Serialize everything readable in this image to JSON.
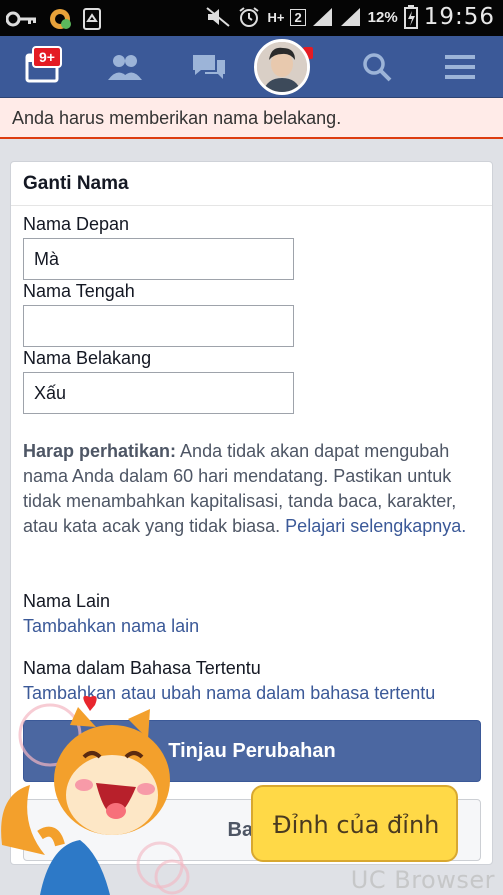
{
  "status_bar": {
    "network": "H+",
    "sim_slot": "2",
    "battery_percent": "12%",
    "time": "19:56"
  },
  "nav": {
    "notifications_badge": "9+",
    "brand_color": "#3b5998"
  },
  "error": {
    "message": "Anda harus memberikan nama belakang."
  },
  "form": {
    "title": "Ganti Nama",
    "first_name_label": "Nama Depan",
    "first_name_value": "Mà",
    "middle_name_label": "Nama Tengah",
    "middle_name_value": "",
    "last_name_label": "Nama Belakang",
    "last_name_value": "Xấu",
    "notice_bold": "Harap perhatikan:",
    "notice_text": " Anda tidak akan dapat mengubah nama Anda dalam 60 hari mendatang. Pastikan untuk tidak menambahkan kapitalisasi, tanda baca, karakter, atau kata acak yang tidak biasa. ",
    "notice_link": "Pelajari selengkapnya.",
    "other_names_label": "Nama Lain",
    "other_names_link": "Tambahkan nama lain",
    "language_names_label": "Nama dalam Bahasa Tertentu",
    "language_names_link": "Tambahkan atau ubah nama dalam bahasa tertentu",
    "review_button": "Tinjau Perubahan",
    "cancel_button": "Batal"
  },
  "overlay": {
    "bubble_text": "Đỉnh của đỉnh",
    "watermark": "UC Browser"
  }
}
